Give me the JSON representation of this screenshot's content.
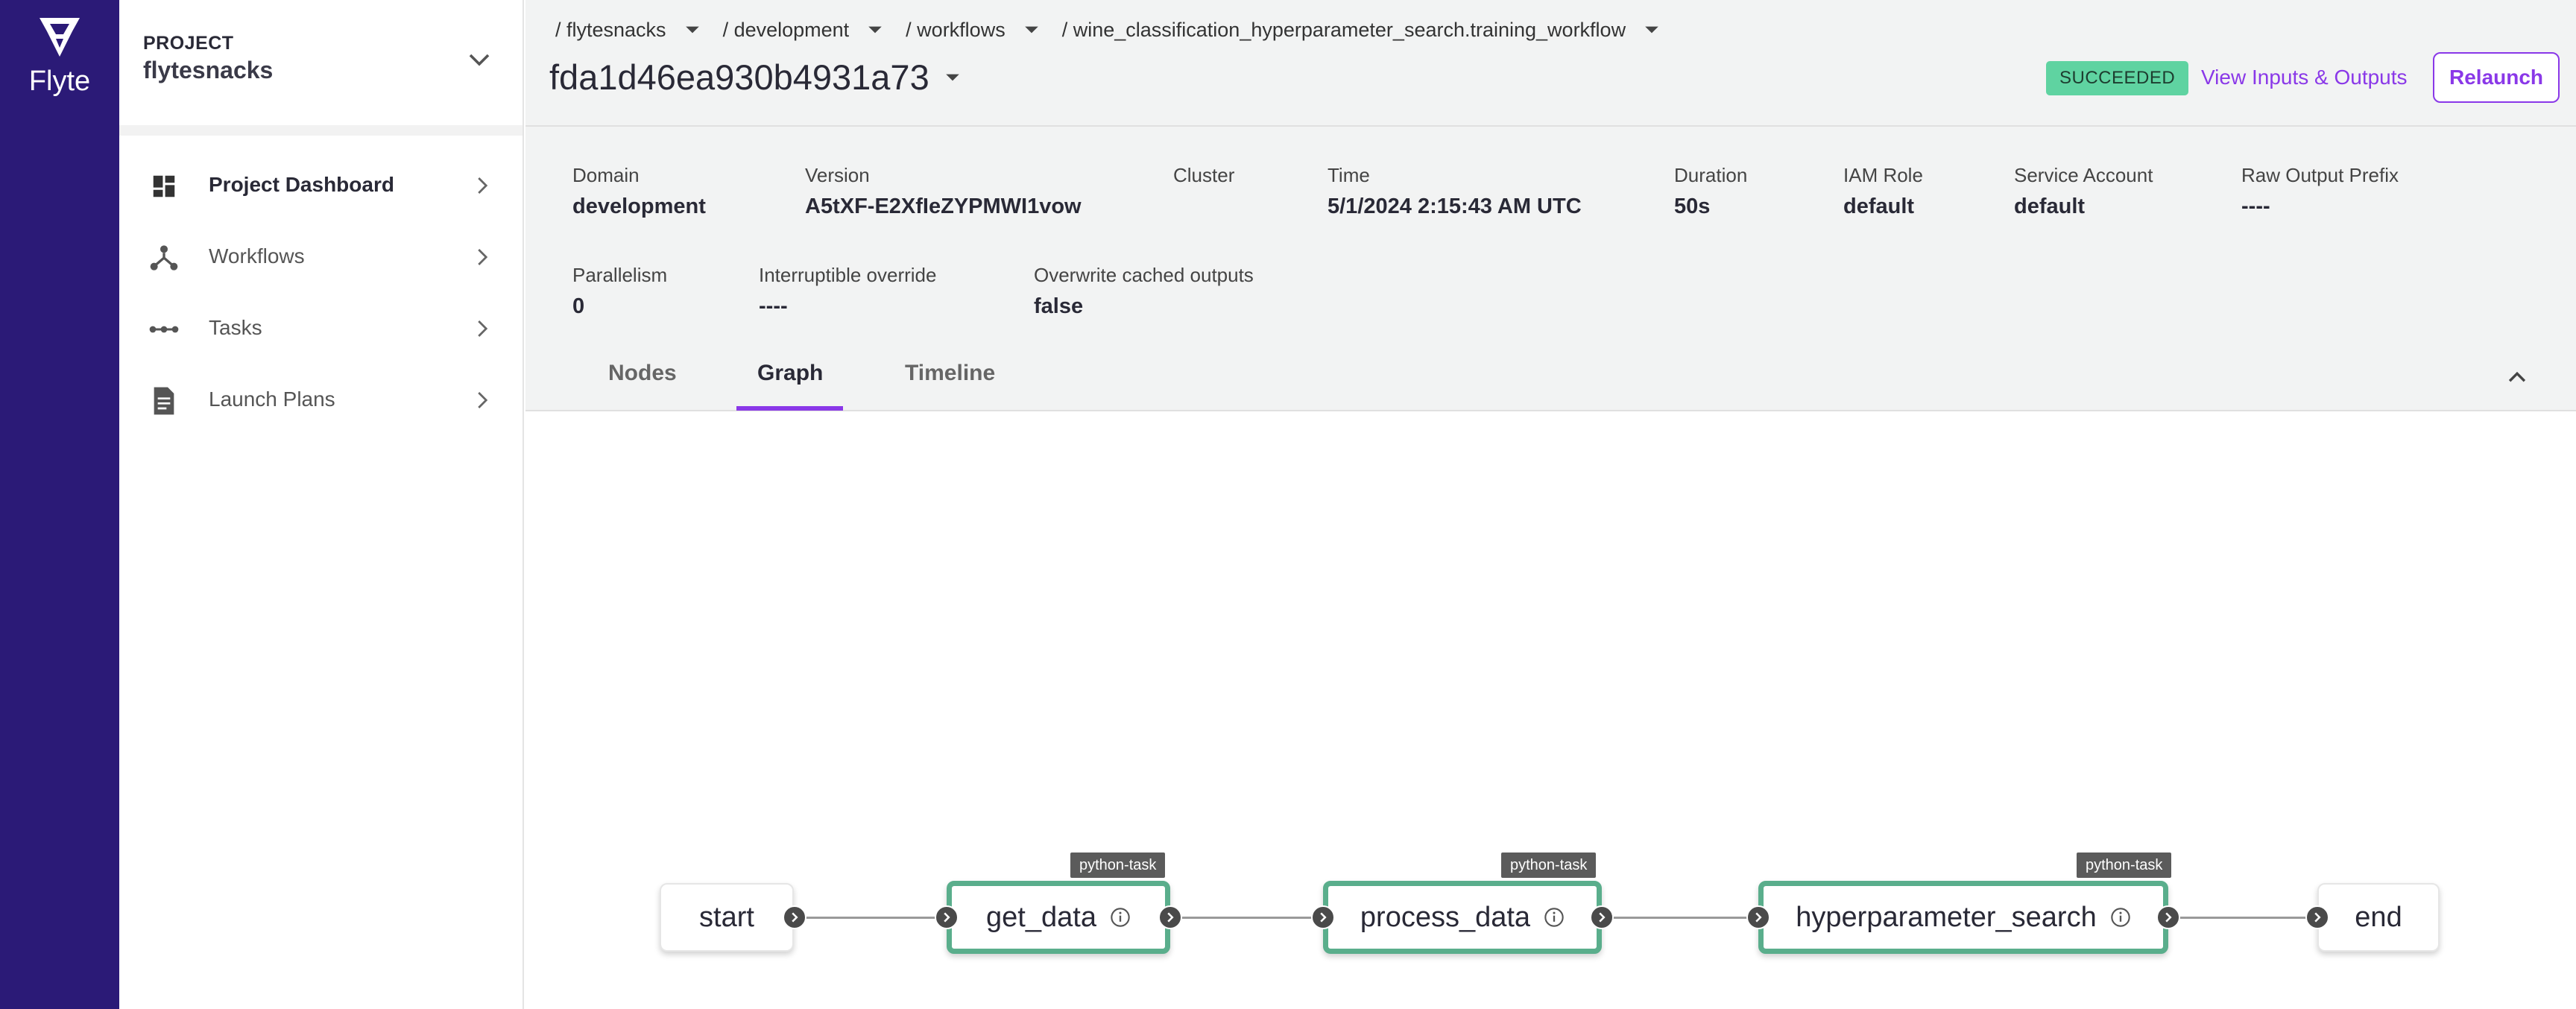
{
  "brand": {
    "name": "Flyte",
    "rail_color": "#2b1a77"
  },
  "project": {
    "caption": "PROJECT",
    "name": "flytesnacks"
  },
  "sidebar": {
    "items": [
      {
        "label": "Project Dashboard",
        "icon": "dashboard-icon",
        "active": true
      },
      {
        "label": "Workflows",
        "icon": "workflow-icon",
        "active": false
      },
      {
        "label": "Tasks",
        "icon": "tasks-icon",
        "active": false
      },
      {
        "label": "Launch Plans",
        "icon": "launch-plan-icon",
        "active": false
      }
    ]
  },
  "breadcrumbs": [
    {
      "label": "/ flytesnacks"
    },
    {
      "label": "/ development"
    },
    {
      "label": "/ workflows"
    },
    {
      "label": "/ wine_classification_hyperparameter_search.training_workflow"
    }
  ],
  "execution": {
    "id": "fda1d46ea930b4931a73",
    "status": "SUCCEEDED",
    "status_color": "#5fd3a1",
    "view_io_label": "View Inputs & Outputs",
    "relaunch_label": "Relaunch",
    "accent_color": "#8a38e8"
  },
  "details": {
    "row1": [
      {
        "label": "Domain",
        "value": "development"
      },
      {
        "label": "Version",
        "value": "A5tXF-E2XfIeZYPMWI1vow"
      },
      {
        "label": "Cluster",
        "value": ""
      },
      {
        "label": "Time",
        "value": "5/1/2024 2:15:43 AM UTC"
      },
      {
        "label": "Duration",
        "value": "50s"
      },
      {
        "label": "IAM Role",
        "value": "default"
      },
      {
        "label": "Service Account",
        "value": "default"
      },
      {
        "label": "Raw Output Prefix",
        "value": "----"
      }
    ],
    "row2": [
      {
        "label": "Parallelism",
        "value": "0"
      },
      {
        "label": "Interruptible override",
        "value": "----"
      },
      {
        "label": "Overwrite cached outputs",
        "value": "false"
      }
    ]
  },
  "tabs": [
    {
      "label": "Nodes",
      "active": false
    },
    {
      "label": "Graph",
      "active": true
    },
    {
      "label": "Timeline",
      "active": false
    }
  ],
  "graph": {
    "nodes": [
      {
        "label": "start",
        "kind": "plain"
      },
      {
        "label": "get_data",
        "kind": "task",
        "tag": "python-task"
      },
      {
        "label": "process_data",
        "kind": "task",
        "tag": "python-task"
      },
      {
        "label": "hyperparameter_search",
        "kind": "task",
        "tag": "python-task"
      },
      {
        "label": "end",
        "kind": "plain"
      }
    ],
    "success_color": "#5aae8c"
  }
}
